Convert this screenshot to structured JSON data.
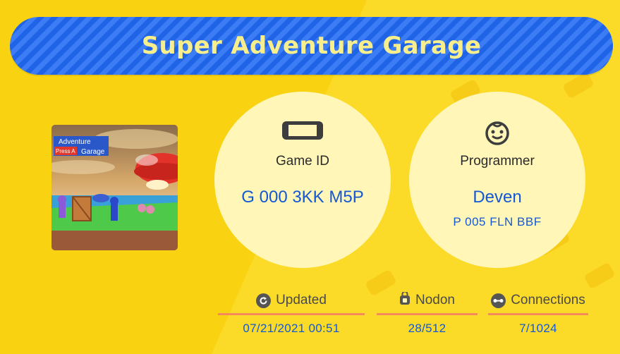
{
  "title": "Super Adventure Garage",
  "thumbnail": {
    "sign_line1": "Adventure",
    "sign_line2": "Press A",
    "sign_line3": "Garage"
  },
  "game": {
    "label": "Game ID",
    "value": "G 000 3KK M5P",
    "icon": "console-icon"
  },
  "programmer": {
    "label": "Programmer",
    "name": "Deven",
    "id": "P 005 FLN BBF",
    "icon": "smiley-face-icon"
  },
  "stats": {
    "updated": {
      "label": "Updated",
      "value": "07/21/2021 00:51",
      "icon": "refresh-icon"
    },
    "nodon": {
      "label": "Nodon",
      "value": "28/512",
      "icon": "nodon-icon"
    },
    "connections": {
      "label": "Connections",
      "value": "7/1024",
      "icon": "connection-icon"
    }
  },
  "colors": {
    "background": "#f9d311",
    "title_bar": "#2a6cf0",
    "title_text": "#f8ef8c",
    "circle": "#fff6b8",
    "value_text": "#1458d6",
    "underline": "#f48a5b"
  }
}
